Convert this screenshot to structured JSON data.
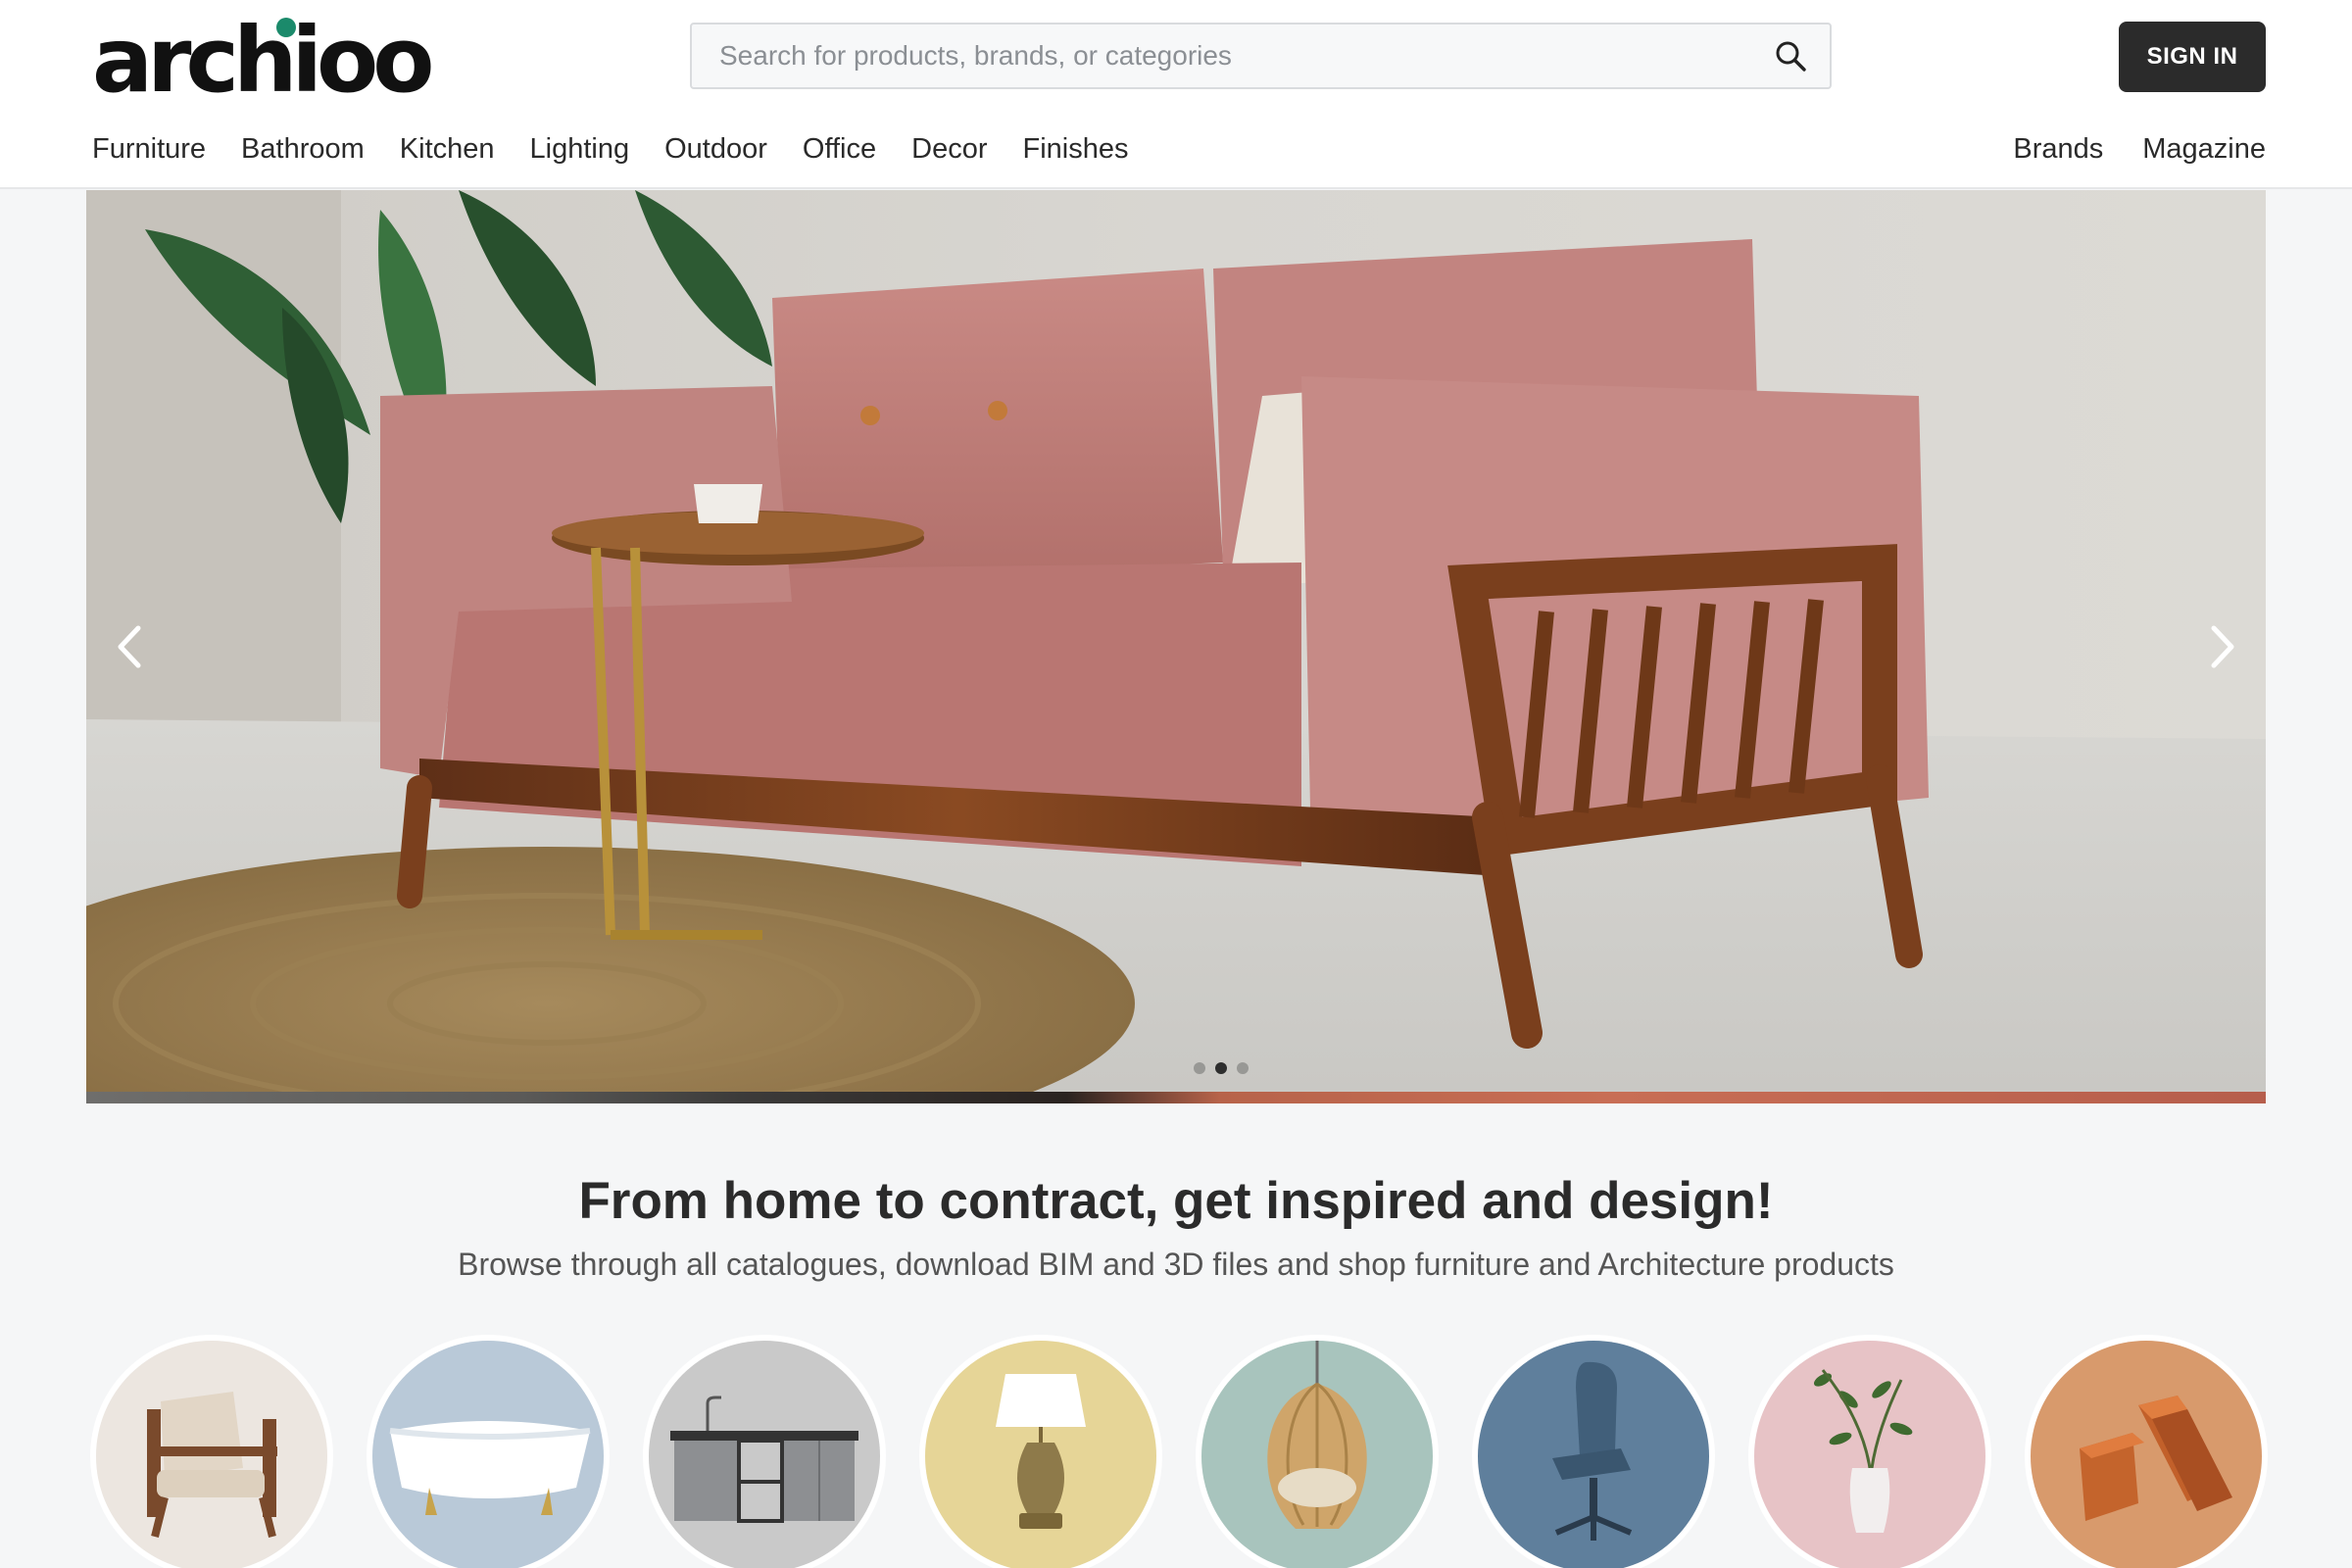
{
  "header": {
    "logo_text": "archioo",
    "search_placeholder": "Search for products, brands, or categories",
    "signin_label": "SIGN IN"
  },
  "nav": {
    "left": [
      "Furniture",
      "Bathroom",
      "Kitchen",
      "Lighting",
      "Outdoor",
      "Office",
      "Decor",
      "Finishes"
    ],
    "right": [
      "Brands",
      "Magazine"
    ]
  },
  "hero": {
    "slides_count": 3,
    "active_slide": 1
  },
  "tagline": {
    "title": "From home to contract, get inspired and design!",
    "subtitle": "Browse through all catalogues, download BIM and 3D files and shop furniture and Architecture products"
  },
  "categories": [
    {
      "icon": "armchair-icon",
      "bg": "#ece6e0"
    },
    {
      "icon": "bathtub-icon",
      "bg": "#b9c9d8"
    },
    {
      "icon": "kitchen-cabinet-icon",
      "bg": "#c9c9c9"
    },
    {
      "icon": "table-lamp-icon",
      "bg": "#e6d597"
    },
    {
      "icon": "hanging-chair-icon",
      "bg": "#a8c4bd"
    },
    {
      "icon": "office-chair-icon",
      "bg": "#5f7f9c"
    },
    {
      "icon": "vase-plant-icon",
      "bg": "#e7c3c6"
    },
    {
      "icon": "bricks-icon",
      "bg": "#d89a6c"
    }
  ],
  "colors": {
    "signin_bg": "#2b2b2b",
    "logo_accent": "#1b8a6b",
    "page_bg": "#f5f6f7"
  }
}
